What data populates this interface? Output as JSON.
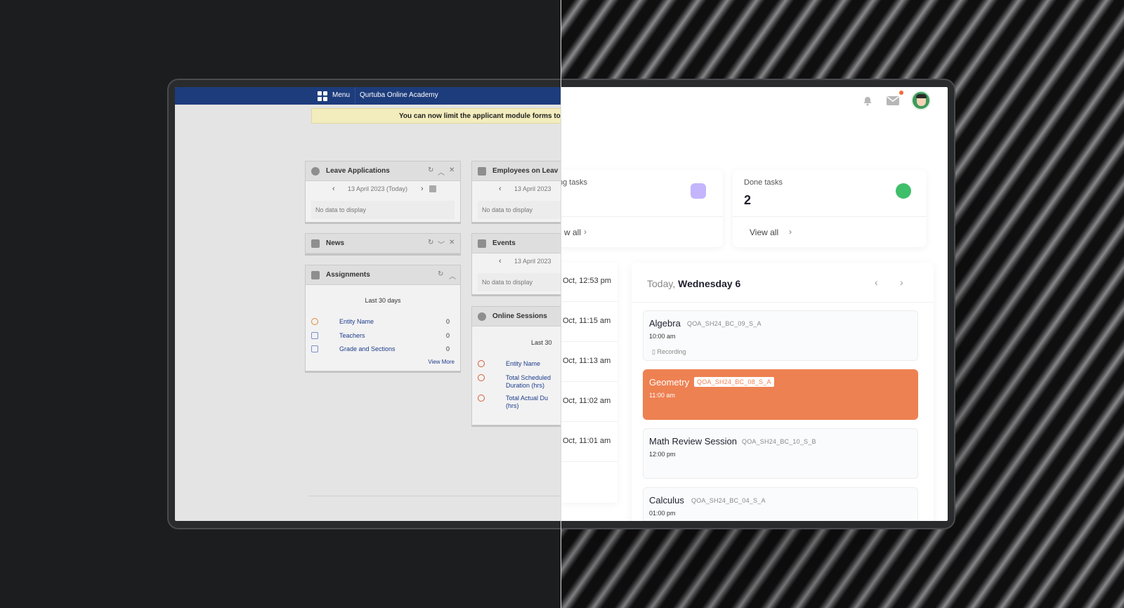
{
  "legacy": {
    "menu_label": "Menu",
    "academy": "Qurtuba Online Academy",
    "banner": "You can now limit the applicant module forms to a s",
    "leave": {
      "title": "Leave Applications",
      "date": "13 April 2023 (Today)",
      "empty": "No data to display"
    },
    "employees": {
      "title": "Employees on Leav",
      "date": "13 April 2023",
      "empty": "No data to display"
    },
    "news": {
      "title": "News"
    },
    "events": {
      "title": "Events",
      "date": "13 April 2023",
      "empty": "No data to display"
    },
    "assignments": {
      "title": "Assignments",
      "period": "Last 30 days",
      "rows": [
        {
          "label": "Entity Name",
          "value": "0"
        },
        {
          "label": "Teachers",
          "value": "0"
        },
        {
          "label": "Grade and Sections",
          "value": "0"
        }
      ],
      "view_more": "View More"
    },
    "sessions": {
      "title": "Online Sessions",
      "period": "Last 30",
      "rows": [
        "Entity Name",
        "Total Scheduled Duration (hrs)",
        "Total Actual Du (hrs)"
      ]
    }
  },
  "modern": {
    "pending_label": "ng tasks",
    "pending_view": "w all",
    "done_label": "Done tasks",
    "done_count": "2",
    "done_view": "View all",
    "timeline": [
      "Oct, 12:53 pm",
      "Oct, 11:15 am",
      "Oct, 11:13 am",
      "Oct, 11:02 am",
      "Oct, 11:01 am"
    ],
    "schedule": {
      "today": "Today,",
      "day": "Wednesday 6",
      "classes": [
        {
          "name": "Algebra",
          "code": "QOA_SH24_BC_09_S_A",
          "time": "10:00 am",
          "note": "Recording"
        },
        {
          "name": "Geometry",
          "code": "QOA_SH24_BC_08_S_A",
          "time": "11:00 am"
        },
        {
          "name": "Math Review Session",
          "code": "QOA_SH24_BC_10_S_B",
          "time": "12:00 pm"
        },
        {
          "name": "Calculus",
          "code": "QOA_SH24_BC_04_S_A",
          "time": "01:00 pm"
        }
      ]
    },
    "colors": {
      "accent": "#ee8152",
      "legacy_header": "#1d3c7c",
      "done_icon": "#3fbf6a",
      "pending_icon": "#a78bfa"
    }
  }
}
